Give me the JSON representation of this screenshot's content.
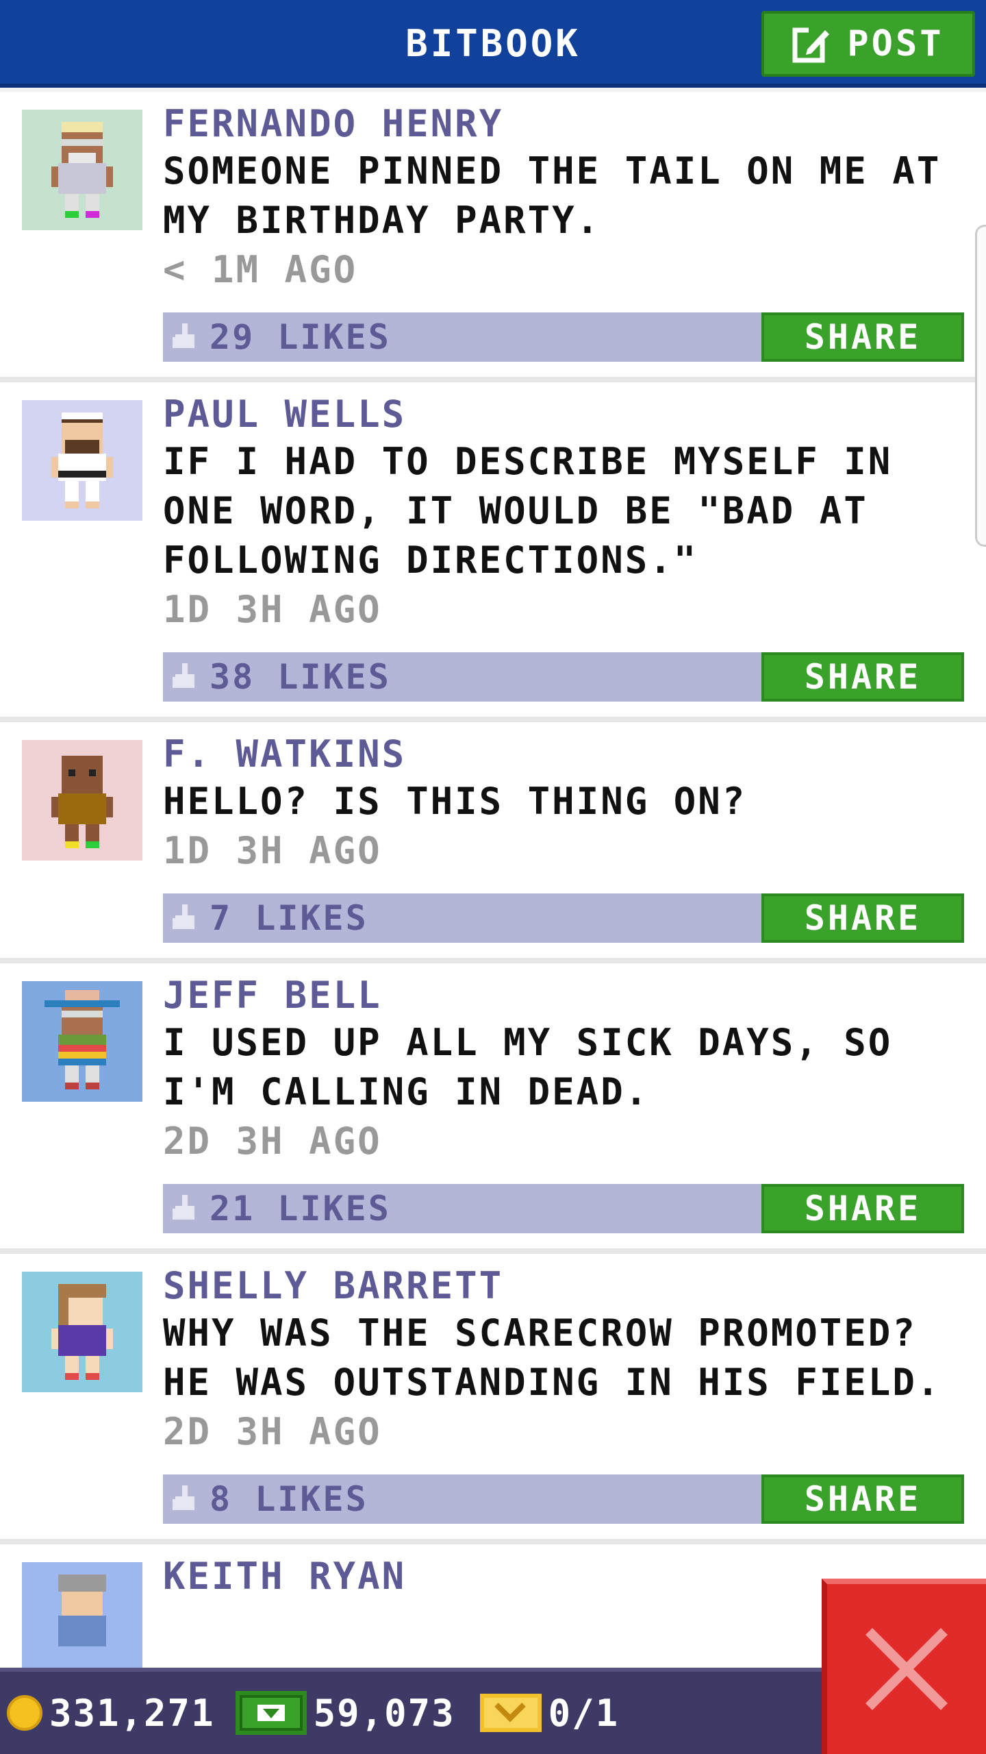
{
  "header": {
    "title": "BITBOOK",
    "post_label": "POST"
  },
  "posts": [
    {
      "author": "FERNANDO HENRY",
      "message": "SOMEONE PINNED THE TAIL ON ME AT MY BIRTHDAY PARTY.",
      "time": "< 1M AGO",
      "likes": "29 LIKES",
      "share_label": "SHARE",
      "avatar_bg": "#c5e2cf"
    },
    {
      "author": "PAUL WELLS",
      "message": "IF I HAD TO DESCRIBE MYSELF IN ONE WORD, IT WOULD BE \"BAD AT FOLLOWING DIRECTIONS.\"",
      "time": "1D 3H AGO",
      "likes": "38 LIKES",
      "share_label": "SHARE",
      "avatar_bg": "#d2d4f2"
    },
    {
      "author": "F. WATKINS",
      "message": "HELLO? IS THIS THING ON?",
      "time": "1D 3H AGO",
      "likes": "7 LIKES",
      "share_label": "SHARE",
      "avatar_bg": "#f0d2d4"
    },
    {
      "author": "JEFF BELL",
      "message": "I USED UP ALL MY SICK DAYS, SO I'M CALLING IN DEAD.",
      "time": "2D 3H AGO",
      "likes": "21 LIKES",
      "share_label": "SHARE",
      "avatar_bg": "#7fa9e0"
    },
    {
      "author": "SHELLY BARRETT",
      "message": "WHY WAS THE SCARECROW PROMOTED? HE WAS OUTSTANDING IN HIS FIELD.",
      "time": "2D 3H AGO",
      "likes": "8 LIKES",
      "share_label": "SHARE",
      "avatar_bg": "#8ccbe0"
    },
    {
      "author": "KEITH RYAN",
      "avatar_bg": "#9db8ee"
    }
  ],
  "footer": {
    "coins": "331,271",
    "bux": "59,073",
    "tickets": "0/1"
  },
  "icons": {
    "post": "edit-icon",
    "like": "thumbs-up-icon",
    "coin": "coin-icon",
    "bux": "cash-icon",
    "ticket": "ticket-icon",
    "close": "close-icon"
  },
  "colors": {
    "header_bg": "#12419b",
    "accent_green": "#3aa12a",
    "like_bar": "#b3b6d6",
    "author_text": "#5e5a96",
    "footer_bg": "#3d3b66",
    "close_red": "#e02a2a"
  }
}
